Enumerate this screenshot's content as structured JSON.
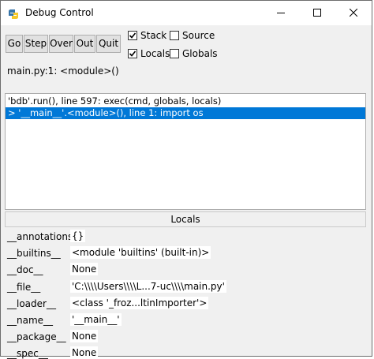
{
  "window": {
    "title": "Debug Control"
  },
  "controls": {
    "go": "Go",
    "step": "Step",
    "over": "Over",
    "out": "Out",
    "quit": "Quit"
  },
  "options": {
    "stack": {
      "label": "Stack",
      "checked": true
    },
    "source": {
      "label": "Source",
      "checked": false
    },
    "locals": {
      "label": "Locals",
      "checked": true
    },
    "globals": {
      "label": "Globals",
      "checked": false
    }
  },
  "status": "main.py:1: <module>()",
  "stack": [
    {
      "text": "'bdb'.run(), line 597: exec(cmd, globals, locals)",
      "selected": false
    },
    {
      "text": "> '__main__'.<module>(), line 1: import os",
      "selected": true
    }
  ],
  "locals": {
    "header": "Locals",
    "rows": [
      {
        "name": "__annotations__",
        "value": "{}"
      },
      {
        "name": "__builtins__",
        "value": "<module 'builtins' (built-in)>"
      },
      {
        "name": "__doc__",
        "value": "None"
      },
      {
        "name": "__file__",
        "value": "'C:\\\\\\\\Users\\\\\\\\L...7-uc\\\\\\\\main.py'"
      },
      {
        "name": "__loader__",
        "value": "<class '_froz...ltinImporter'>"
      },
      {
        "name": "__name__",
        "value": "'__main__'"
      },
      {
        "name": "__package__",
        "value": "None"
      },
      {
        "name": "__spec__",
        "value": "None"
      }
    ]
  }
}
